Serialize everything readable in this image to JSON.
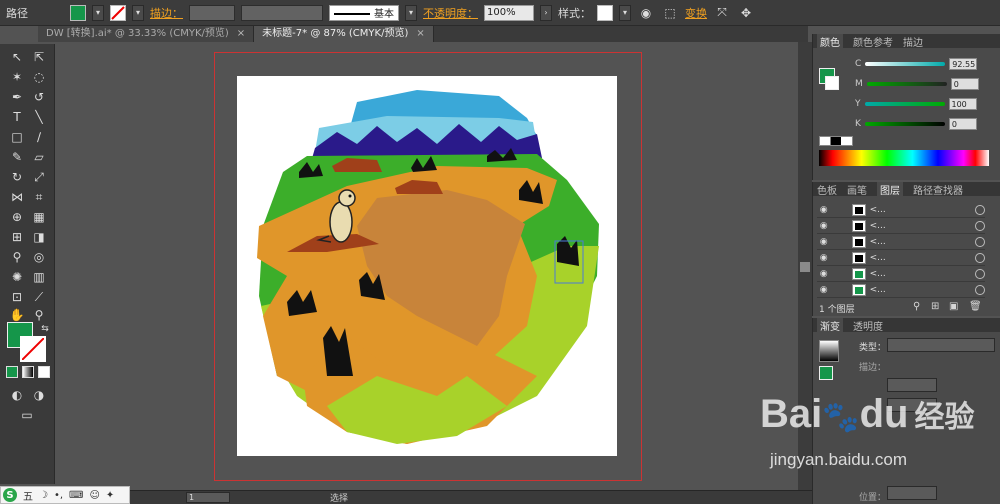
{
  "toolbar_top": {
    "label_path": "路径",
    "label_stroke": "描边：",
    "stroke_style": "基本",
    "label_opacity": "不透明度：",
    "opacity_value": "100%",
    "label_style": "样式：",
    "label_transform": "变换"
  },
  "tabs": [
    {
      "label": "DW [转换].ai* @ 33.33% (CMYK/预览)",
      "close": "×"
    },
    {
      "label": "未标题-7* @ 87% (CMYK/预览)",
      "close": "×"
    }
  ],
  "colors": {
    "fill": "#15964a",
    "sky": "#3aa8d8",
    "sky_light": "#7ccde6",
    "mountain": "#2a1a8a",
    "grass": "#3cae2a",
    "grass_light": "#a8d22a",
    "dirt": "#e0962a",
    "dirt_dark": "#c8843a",
    "mound": "#a0401a"
  },
  "color_panel": {
    "tabs": [
      "颜色",
      "颜色参考",
      "描边"
    ],
    "channels": [
      {
        "name": "C",
        "value": "92.55"
      },
      {
        "name": "M",
        "value": "0"
      },
      {
        "name": "Y",
        "value": "100"
      },
      {
        "name": "K",
        "value": "0"
      }
    ]
  },
  "layers_panel": {
    "tabs": [
      "色板",
      "画笔",
      "图层",
      "路径查找器"
    ],
    "rows": [
      "<...",
      "<...",
      "<...",
      "<...",
      "<...",
      "<..."
    ],
    "footer": "1 个图层"
  },
  "gradient_panel": {
    "tabs": [
      "渐变",
      "透明度"
    ],
    "type_label": "类型：",
    "stroke_label": "描边：",
    "position_label": "位置："
  },
  "status": {
    "zoom": "1",
    "mode": "选择"
  },
  "ime": {
    "logo": "S",
    "text": "五"
  },
  "watermark": {
    "brand": "Bai",
    "brand2": "du",
    "cn": "经验",
    "url": "jingyan.baidu.com"
  }
}
